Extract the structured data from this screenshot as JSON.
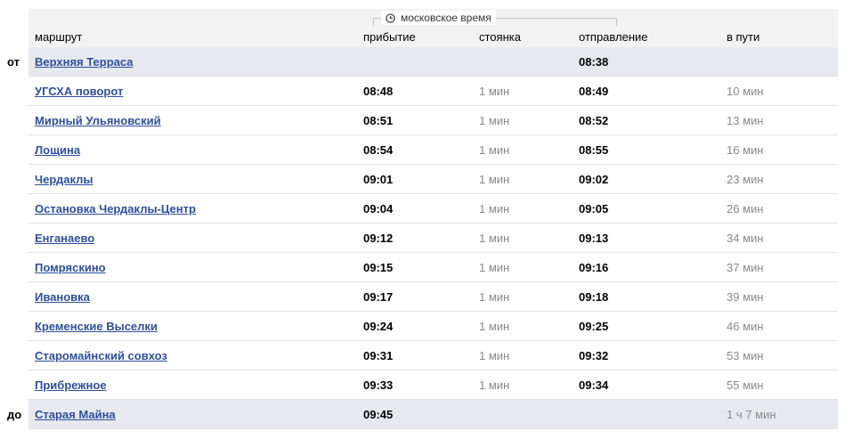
{
  "timezone_label": "московское время",
  "headers": {
    "route": "маршрут",
    "arrival": "прибытие",
    "stop": "стоянка",
    "departure": "отправление",
    "travel": "в пути"
  },
  "stops": [
    {
      "prefix": "от",
      "name": "Верхняя Терраса",
      "arrival": "",
      "stop": "",
      "departure": "08:38",
      "travel": ""
    },
    {
      "prefix": "",
      "name": "УГСХА поворот",
      "arrival": "08:48",
      "stop": "1 мин",
      "departure": "08:49",
      "travel": "10 мин"
    },
    {
      "prefix": "",
      "name": "Мирный Ульяновский",
      "arrival": "08:51",
      "stop": "1 мин",
      "departure": "08:52",
      "travel": "13 мин"
    },
    {
      "prefix": "",
      "name": "Лощина",
      "arrival": "08:54",
      "stop": "1 мин",
      "departure": "08:55",
      "travel": "16 мин"
    },
    {
      "prefix": "",
      "name": "Чердаклы",
      "arrival": "09:01",
      "stop": "1 мин",
      "departure": "09:02",
      "travel": "23 мин"
    },
    {
      "prefix": "",
      "name": "Остановка Чердаклы-Центр",
      "arrival": "09:04",
      "stop": "1 мин",
      "departure": "09:05",
      "travel": "26 мин"
    },
    {
      "prefix": "",
      "name": "Енганаево",
      "arrival": "09:12",
      "stop": "1 мин",
      "departure": "09:13",
      "travel": "34 мин"
    },
    {
      "prefix": "",
      "name": "Помряскино",
      "arrival": "09:15",
      "stop": "1 мин",
      "departure": "09:16",
      "travel": "37 мин"
    },
    {
      "prefix": "",
      "name": "Ивановка",
      "arrival": "09:17",
      "stop": "1 мин",
      "departure": "09:18",
      "travel": "39 мин"
    },
    {
      "prefix": "",
      "name": "Кременские Выселки",
      "arrival": "09:24",
      "stop": "1 мин",
      "departure": "09:25",
      "travel": "46 мин"
    },
    {
      "prefix": "",
      "name": "Старомайнский совхоз",
      "arrival": "09:31",
      "stop": "1 мин",
      "departure": "09:32",
      "travel": "53 мин"
    },
    {
      "prefix": "",
      "name": "Прибрежное",
      "arrival": "09:33",
      "stop": "1 мин",
      "departure": "09:34",
      "travel": "55 мин"
    },
    {
      "prefix": "до",
      "name": "Старая Майна",
      "arrival": "09:45",
      "stop": "",
      "departure": "",
      "travel": "1 ч 7 мин"
    }
  ],
  "colors": {
    "link": "#2d4f9e",
    "edge_row_bg": "#e8e9ef",
    "header_bg": "#f2f2f2",
    "muted_text": "#888888"
  }
}
